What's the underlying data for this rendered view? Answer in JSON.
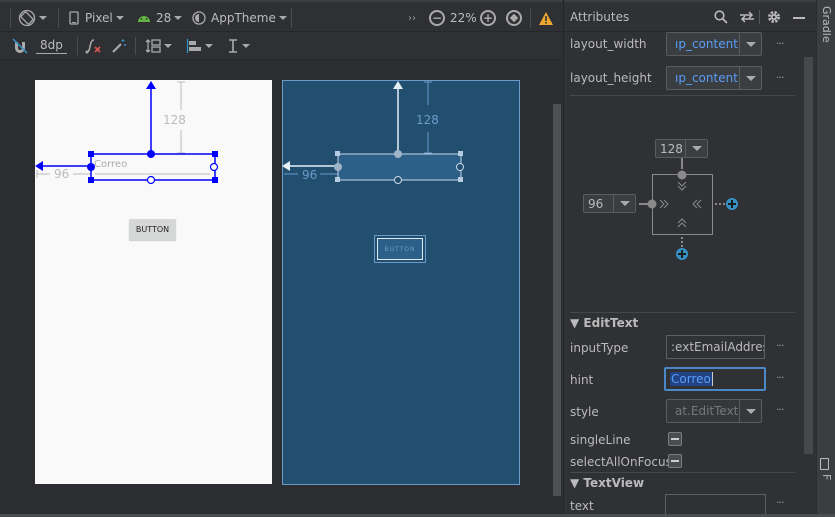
{
  "toolbar_top": {
    "orientation_icon": "rotate-device-icon",
    "device": "Pixel",
    "api_level": "28",
    "theme": "AppTheme",
    "overflow": "››",
    "zoom_level": "22%",
    "warning_icon": "warning-icon"
  },
  "toolbar_second": {
    "margin_default": "8dp"
  },
  "design": {
    "edittext_hint": "Correo",
    "button_label": "BUTTON",
    "margin_top": "128",
    "margin_start": "96"
  },
  "blueprint": {
    "button_label": "BUTTON",
    "margin_top": "128",
    "margin_start": "96"
  },
  "attributes": {
    "title": "Attributes",
    "layout_width": {
      "label": "layout_width",
      "value": "ıp_content"
    },
    "layout_height": {
      "label": "layout_height",
      "value": "ıp_content"
    },
    "constraint_widget": {
      "top_margin": "128",
      "start_margin": "96"
    },
    "edittext_section": "EditText",
    "input_type": {
      "label": "inputType",
      "value": ":extEmailAddress"
    },
    "hint": {
      "label": "hint",
      "value": "Correo"
    },
    "style": {
      "label": "style",
      "value": "at.EditText"
    },
    "single_line": {
      "label": "singleLine"
    },
    "select_all_on_focus": {
      "label": "selectAllOnFocus"
    },
    "textview_section": "TextView",
    "text": {
      "label": "text",
      "value": ""
    },
    "more": "···"
  },
  "side_tabs": {
    "gradle": "Gradle",
    "device_file": "Device F"
  },
  "colors": {
    "accent_blue": "#0000ff",
    "blueprint_bg": "#224e70",
    "plus_blue": "#3592c4",
    "warning": "#f0a732",
    "selection": "#214283"
  }
}
